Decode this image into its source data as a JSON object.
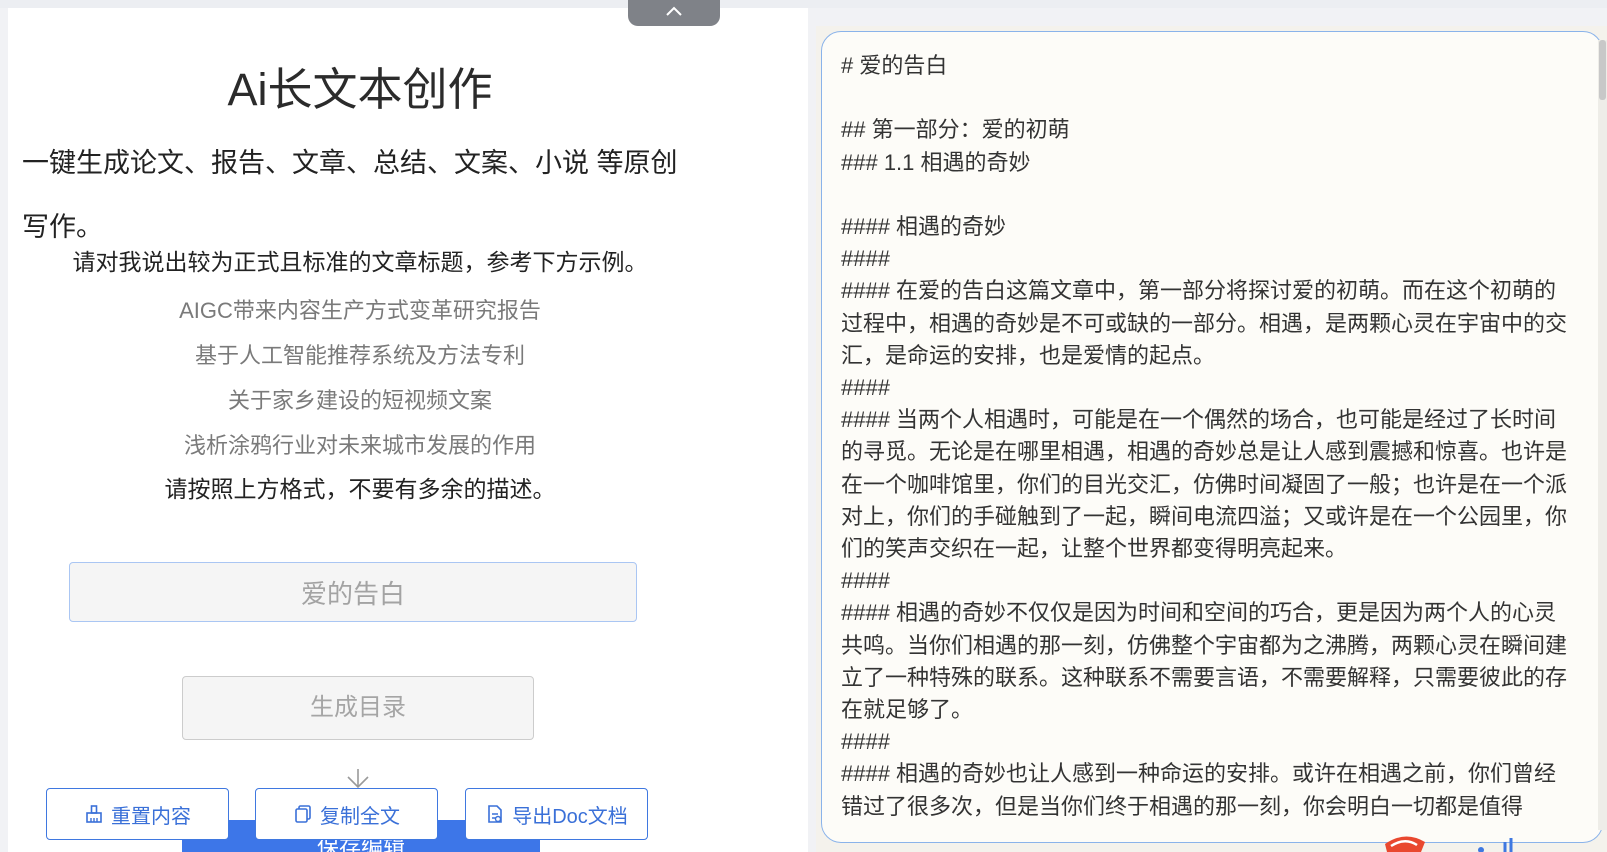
{
  "colors": {
    "accent": "#3f78e0",
    "input_border": "#aac6f3",
    "doc_border": "#8ab3ea",
    "doc_background": "#fdfcf8",
    "primary_button": "#3d76e8"
  },
  "header": {
    "collapse_icon": "chevron-up-icon"
  },
  "left": {
    "title": "Ai长文本创作",
    "tagline": "一键生成论文、报告、文章、总结、文案、小说 等原创写作。",
    "instruction": "请对我说出较为正式且标准的文章标题，参考下方示例。",
    "examples": [
      "AIGC带来内容生产方式变革研究报告",
      "基于人工智能推荐系统及方法专利",
      "关于家乡建设的短视频文案",
      "浅析涂鸦行业对未来城市发展的作用"
    ],
    "format_note": "请按照上方格式，不要有多余的描述。",
    "input": {
      "value": "爱的告白",
      "placeholder": "爱的告白"
    },
    "generate_button": "生成目录",
    "arrow_icon": "arrow-down-icon",
    "hidden_button": "保存编辑",
    "actions": [
      {
        "label": "重置内容",
        "icon": "reset-icon"
      },
      {
        "label": "复制全文",
        "icon": "copy-icon"
      },
      {
        "label": "导出Doc文档",
        "icon": "export-doc-icon"
      }
    ]
  },
  "document": {
    "lines": [
      "# 爱的告白",
      "",
      "## 第一部分：爱的初萌",
      "### 1.1 相遇的奇妙",
      "",
      "#### 相遇的奇妙",
      "####",
      "#### 在爱的告白这篇文章中，第一部分将探讨爱的初萌。而在这个初萌的过程中，相遇的奇妙是不可或缺的一部分。相遇，是两颗心灵在宇宙中的交汇，是命运的安排，也是爱情的起点。",
      "####",
      "#### 当两个人相遇时，可能是在一个偶然的场合，也可能是经过了长时间的寻觅。无论是在哪里相遇，相遇的奇妙总是让人感到震撼和惊喜。也许是在一个咖啡馆里，你们的目光交汇，仿佛时间凝固了一般；也许是在一个派对上，你们的手碰触到了一起，瞬间电流四溢；又或许是在一个公园里，你们的笑声交织在一起，让整个世界都变得明亮起来。",
      "####",
      "#### 相遇的奇妙不仅仅是因为时间和空间的巧合，更是因为两个人的心灵共鸣。当你们相遇的那一刻，仿佛整个宇宙都为之沸腾，两颗心灵在瞬间建立了一种特殊的联系。这种联系不需要言语，不需要解释，只需要彼此的存在就足够了。",
      "####",
      "#### 相遇的奇妙也让人感到一种命运的安排。或许在相遇之前，你们曾经错过了很多次，但是当你们终于相遇的那一刻，你会明白一切都是值得"
    ]
  }
}
